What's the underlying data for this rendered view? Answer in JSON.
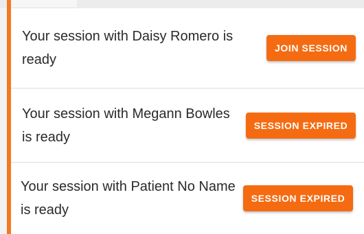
{
  "sessions": [
    {
      "message": "Your session with Daisy Romero is ready",
      "action_label": "JOIN SESSION"
    },
    {
      "message": "Your session with Megann Bowles is ready",
      "action_label": "SESSION EXPIRED"
    },
    {
      "message": "Your session with Patient No Name is ready",
      "action_label": "SESSION EXPIRED"
    }
  ],
  "colors": {
    "accent": "#f27a21",
    "button": "#f56b12",
    "button_text": "#ffffff",
    "text": "#2a2a2a",
    "divider": "#dedede"
  }
}
